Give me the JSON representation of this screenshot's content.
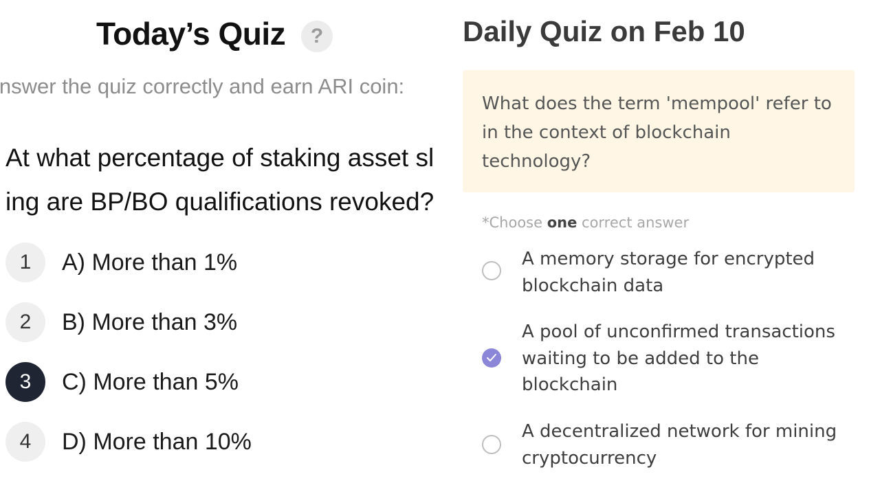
{
  "left_panel": {
    "title": "Today’s Quiz",
    "help_icon": "?",
    "subtitle": "ɩnswer the quiz correctly and earn ARI coin:",
    "question_lines": [
      "At what percentage of staking asset sl",
      "ing are BP/BO qualifications revoked?"
    ],
    "options": [
      {
        "number": "1",
        "label": "A) More than 1%",
        "selected": false
      },
      {
        "number": "2",
        "label": "B) More than 3%",
        "selected": false
      },
      {
        "number": "3",
        "label": "C) More than 5%",
        "selected": true
      },
      {
        "number": "4",
        "label": "D) More than 10%",
        "selected": false
      }
    ]
  },
  "right_panel": {
    "title": "Daily Quiz on Feb 10",
    "question": "What does the term 'mempool' refer to in the context of blockchain technology?",
    "hint_prefix": "*Choose ",
    "hint_emphasis": "one",
    "hint_suffix": " correct answer",
    "answers": [
      {
        "text": "A memory storage for encrypted blockchain data",
        "checked": false
      },
      {
        "text": "A pool of unconfirmed transactions waiting to be added to the blockchain",
        "checked": true
      },
      {
        "text": "A decentralized network for mining cryptocurrency",
        "checked": false
      }
    ]
  },
  "colors": {
    "selected_number_bg": "#1f2533",
    "checked_radio": "#8b86d8",
    "question_card_bg": "#fff6e5"
  },
  "icons": {
    "help": "question-mark-icon",
    "checked": "checkmark-icon"
  }
}
